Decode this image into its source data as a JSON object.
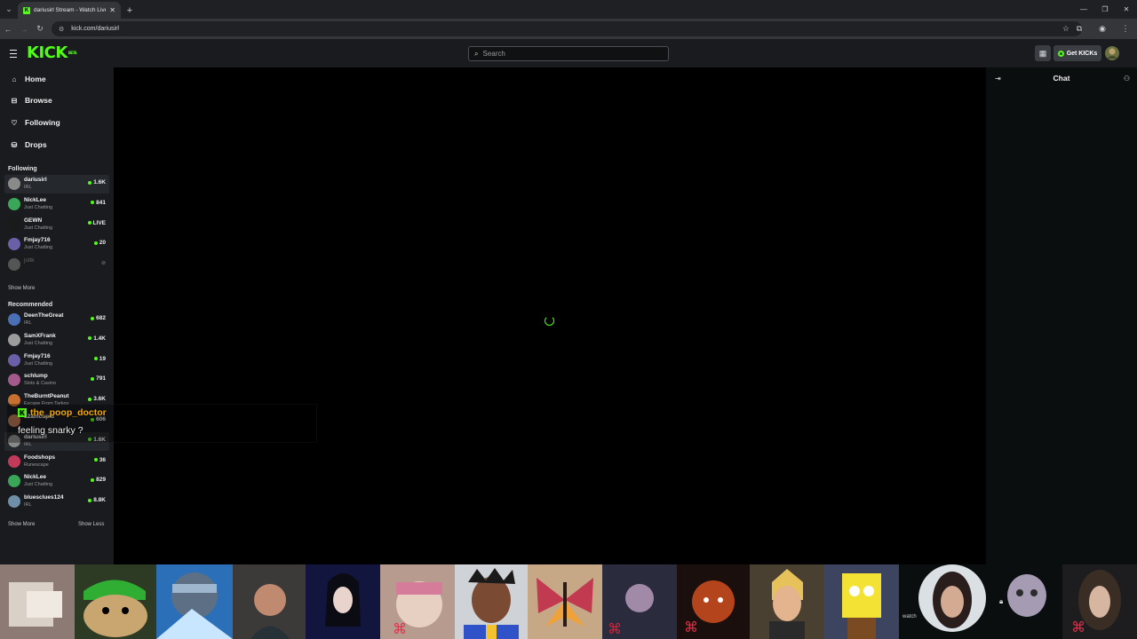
{
  "browser": {
    "tab_title": "dariusirl Stream - Watch Live o",
    "url": "kick.com/dariusirl"
  },
  "header": {
    "logo": "KICK",
    "logo_tag": "BETA",
    "search_placeholder": "Search",
    "get_kicks": "Get KICKs"
  },
  "nav": [
    "Home",
    "Browse",
    "Following",
    "Drops"
  ],
  "following": {
    "title": "Following",
    "channels": [
      {
        "name": "dariusirl",
        "category": "IRL",
        "viewers": "1.6K",
        "color": "#8a8a8a"
      },
      {
        "name": "NickLee",
        "category": "Just Chatting",
        "viewers": "841",
        "color": "#3aa657"
      },
      {
        "name": "GEWN",
        "category": "Just Chatting",
        "viewers": "LIVE",
        "color": "#1a1a1a"
      },
      {
        "name": "Fmjay716",
        "category": "Just Chatting",
        "viewers": "20",
        "color": "#6b5fa8"
      },
      {
        "name": "jsttk",
        "category": "",
        "viewers": "",
        "color": "#555555"
      }
    ],
    "show_more": "Show More"
  },
  "recommended": {
    "title": "Recommended",
    "channels": [
      {
        "name": "DeenTheGreat",
        "category": "IRL",
        "viewers": "682",
        "color": "#4a6fb5"
      },
      {
        "name": "SamXFrank",
        "category": "Just Chatting",
        "viewers": "1.4K",
        "color": "#9c9c9c"
      },
      {
        "name": "Fmjay716",
        "category": "Just Chatting",
        "viewers": "19",
        "color": "#6b5fa8"
      },
      {
        "name": "schlump",
        "category": "Slots & Casino",
        "viewers": "791",
        "color": "#a45a8a"
      },
      {
        "name": "TheBurntPeanut",
        "category": "Escape From Tarkov",
        "viewers": "3.6K",
        "color": "#c7702f"
      },
      {
        "name": "12amcupid",
        "category": "",
        "viewers": "606",
        "color": "#b07050"
      },
      {
        "name": "dariusirl",
        "category": "IRL",
        "viewers": "1.6K",
        "color": "#8a8a8a"
      },
      {
        "name": "Foodshops",
        "category": "Runescape",
        "viewers": "36",
        "color": "#c23a5a"
      },
      {
        "name": "NickLee",
        "category": "Just Chatting",
        "viewers": "829",
        "color": "#3aa657"
      },
      {
        "name": "bluesclues124",
        "category": "IRL",
        "viewers": "8.8K",
        "color": "#6f8fa8"
      }
    ],
    "show_more": "Show More",
    "show_less": "Show Less"
  },
  "chat": {
    "title": "Chat"
  },
  "overlay": {
    "username": "the_poop_doctor",
    "message": "feeling snarky ?"
  },
  "strip": {
    "watch_text": "watch"
  },
  "colors": {
    "accent": "#53fc18",
    "sidebar_bg": "#191b1f",
    "overlay_user": "#f2a900"
  }
}
